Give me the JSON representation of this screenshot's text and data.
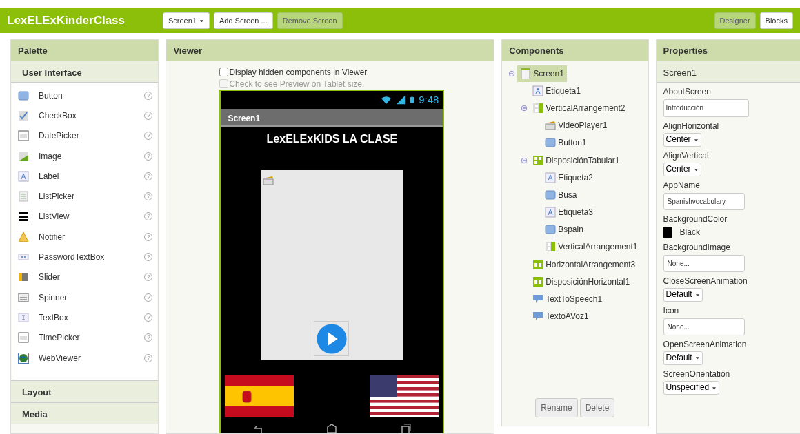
{
  "topbar": {
    "app_title": "LexELExKinderClass",
    "screen_selector": "Screen1",
    "add_screen": "Add Screen ...",
    "remove_screen": "Remove Screen",
    "views": [
      {
        "label": "Designer",
        "selected": true
      },
      {
        "label": "Blocks",
        "selected": false
      }
    ]
  },
  "palette": {
    "title": "Palette",
    "open_section": "User Interface",
    "items": [
      {
        "label": "Button",
        "kind": "button"
      },
      {
        "label": "CheckBox",
        "kind": "checkbox"
      },
      {
        "label": "DatePicker",
        "kind": "datepicker"
      },
      {
        "label": "Image",
        "kind": "image"
      },
      {
        "label": "Label",
        "kind": "label"
      },
      {
        "label": "ListPicker",
        "kind": "listpicker"
      },
      {
        "label": "ListView",
        "kind": "listview"
      },
      {
        "label": "Notifier",
        "kind": "notifier"
      },
      {
        "label": "PasswordTextBox",
        "kind": "password"
      },
      {
        "label": "Slider",
        "kind": "slider"
      },
      {
        "label": "Spinner",
        "kind": "spinner"
      },
      {
        "label": "TextBox",
        "kind": "textbox"
      },
      {
        "label": "TimePicker",
        "kind": "timepicker"
      },
      {
        "label": "WebViewer",
        "kind": "webviewer"
      }
    ],
    "help_mark": "?",
    "sections": [
      "Layout",
      "Media"
    ]
  },
  "viewer": {
    "title": "Viewer",
    "options": [
      {
        "label": "Display hidden components in Viewer",
        "checked": false,
        "disabled": false
      },
      {
        "label": "Check to see Preview on Tablet size.",
        "checked": false,
        "disabled": true
      }
    ],
    "phone": {
      "time": "9:48",
      "screen_title": "Screen1",
      "heading": "LexELExKIDS LA CLASE"
    }
  },
  "components": {
    "title": "Components",
    "tree": [
      {
        "label": "Screen1",
        "kind": "screen",
        "selected": true,
        "expanded": true,
        "children": [
          {
            "label": "Etiqueta1",
            "kind": "label",
            "selected": false
          },
          {
            "label": "VerticalArrangement2",
            "kind": "vertical",
            "selected": false,
            "expanded": true,
            "children": [
              {
                "label": "VideoPlayer1",
                "kind": "video",
                "selected": false
              },
              {
                "label": "Button1",
                "kind": "button",
                "selected": false
              }
            ]
          },
          {
            "label": "DisposiciónTabular1",
            "kind": "table",
            "selected": false,
            "expanded": true,
            "children": [
              {
                "label": "Etiqueta2",
                "kind": "label",
                "selected": false
              },
              {
                "label": "Busa",
                "kind": "button",
                "selected": false
              },
              {
                "label": "Etiqueta3",
                "kind": "label",
                "selected": false
              },
              {
                "label": "Bspain",
                "kind": "button",
                "selected": false
              },
              {
                "label": "VerticalArrangement1",
                "kind": "vertical",
                "selected": false
              }
            ]
          },
          {
            "label": "HorizontalArrangement3",
            "kind": "horizontal",
            "selected": false
          },
          {
            "label": "DisposiciónHorizontal1",
            "kind": "horizontal",
            "selected": false
          },
          {
            "label": "TextToSpeech1",
            "kind": "speech",
            "selected": false
          },
          {
            "label": "TextoAVoz1",
            "kind": "speech",
            "selected": false
          }
        ]
      }
    ],
    "buttons": [
      "Rename",
      "Delete"
    ]
  },
  "properties": {
    "title": "Properties",
    "component": "Screen1",
    "items": [
      {
        "name": "AboutScreen",
        "kind": "textarea",
        "value": "Introducción"
      },
      {
        "name": "AlignHorizontal",
        "kind": "dropdown",
        "value": "Center"
      },
      {
        "name": "AlignVertical",
        "kind": "dropdown",
        "value": "Center"
      },
      {
        "name": "AppName",
        "kind": "text",
        "value": "Spanishvocabulary"
      },
      {
        "name": "BackgroundColor",
        "kind": "color",
        "value": "Black",
        "color": "#000000"
      },
      {
        "name": "BackgroundImage",
        "kind": "text",
        "value": "None..."
      },
      {
        "name": "CloseScreenAnimation",
        "kind": "dropdown",
        "value": "Default"
      },
      {
        "name": "Icon",
        "kind": "text",
        "value": "None..."
      },
      {
        "name": "OpenScreenAnimation",
        "kind": "dropdown",
        "value": "Default"
      },
      {
        "name": "ScreenOrientation",
        "kind": "dropdown",
        "value": "Unspecified"
      }
    ]
  }
}
